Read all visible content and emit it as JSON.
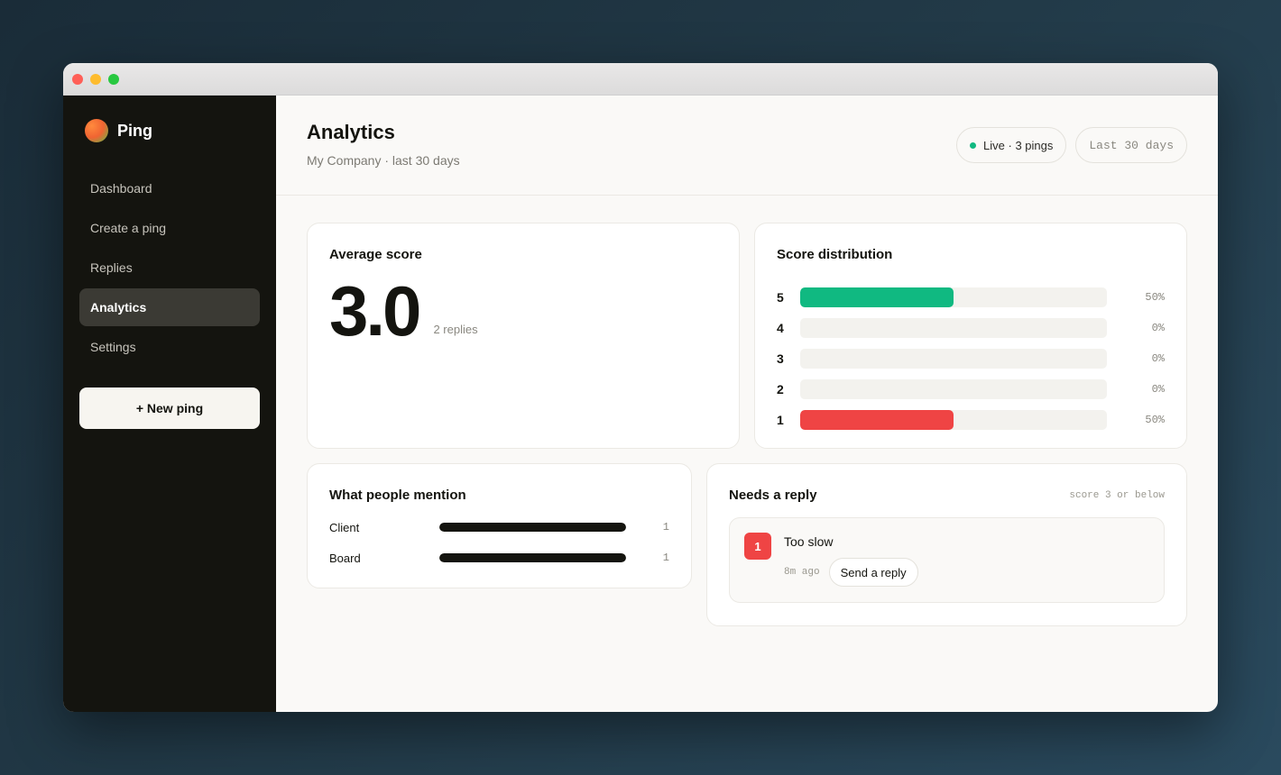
{
  "app": {
    "name": "Ping"
  },
  "sidebar": {
    "items": [
      {
        "label": "Dashboard",
        "active": false
      },
      {
        "label": "Create a ping",
        "active": false
      },
      {
        "label": "Replies",
        "active": false
      },
      {
        "label": "Analytics",
        "active": true
      },
      {
        "label": "Settings",
        "active": false
      }
    ],
    "new_ping_label": "+ New ping"
  },
  "header": {
    "title": "Analytics",
    "subtitle": "My Company · last 30 days",
    "live_label": "Live · 3 pings",
    "range_label": "Last 30 days"
  },
  "average": {
    "title": "Average score",
    "value": "3.0",
    "replies": "2 replies"
  },
  "distribution": {
    "title": "Score distribution",
    "rows": [
      {
        "score": "5",
        "pct": "50%",
        "fraction": 0.5,
        "color": "#10b981"
      },
      {
        "score": "4",
        "pct": "0%",
        "fraction": 0,
        "color": "#10b981"
      },
      {
        "score": "3",
        "pct": "0%",
        "fraction": 0,
        "color": "#f59e0b"
      },
      {
        "score": "2",
        "pct": "0%",
        "fraction": 0,
        "color": "#ef4444"
      },
      {
        "score": "1",
        "pct": "50%",
        "fraction": 0.5,
        "color": "#ef4444"
      }
    ]
  },
  "mentions": {
    "title": "What people mention",
    "rows": [
      {
        "label": "Client",
        "count": "1",
        "fraction": 1
      },
      {
        "label": "Board",
        "count": "1",
        "fraction": 1
      }
    ]
  },
  "needs_reply": {
    "title": "Needs a reply",
    "hint": "score 3 or below",
    "items": [
      {
        "score": "1",
        "text": "Too slow",
        "time": "8m ago",
        "action": "Send a reply"
      }
    ]
  },
  "colors": {
    "accent_green": "#10b981",
    "accent_red": "#ef4444",
    "sidebar_bg": "#14140f"
  }
}
